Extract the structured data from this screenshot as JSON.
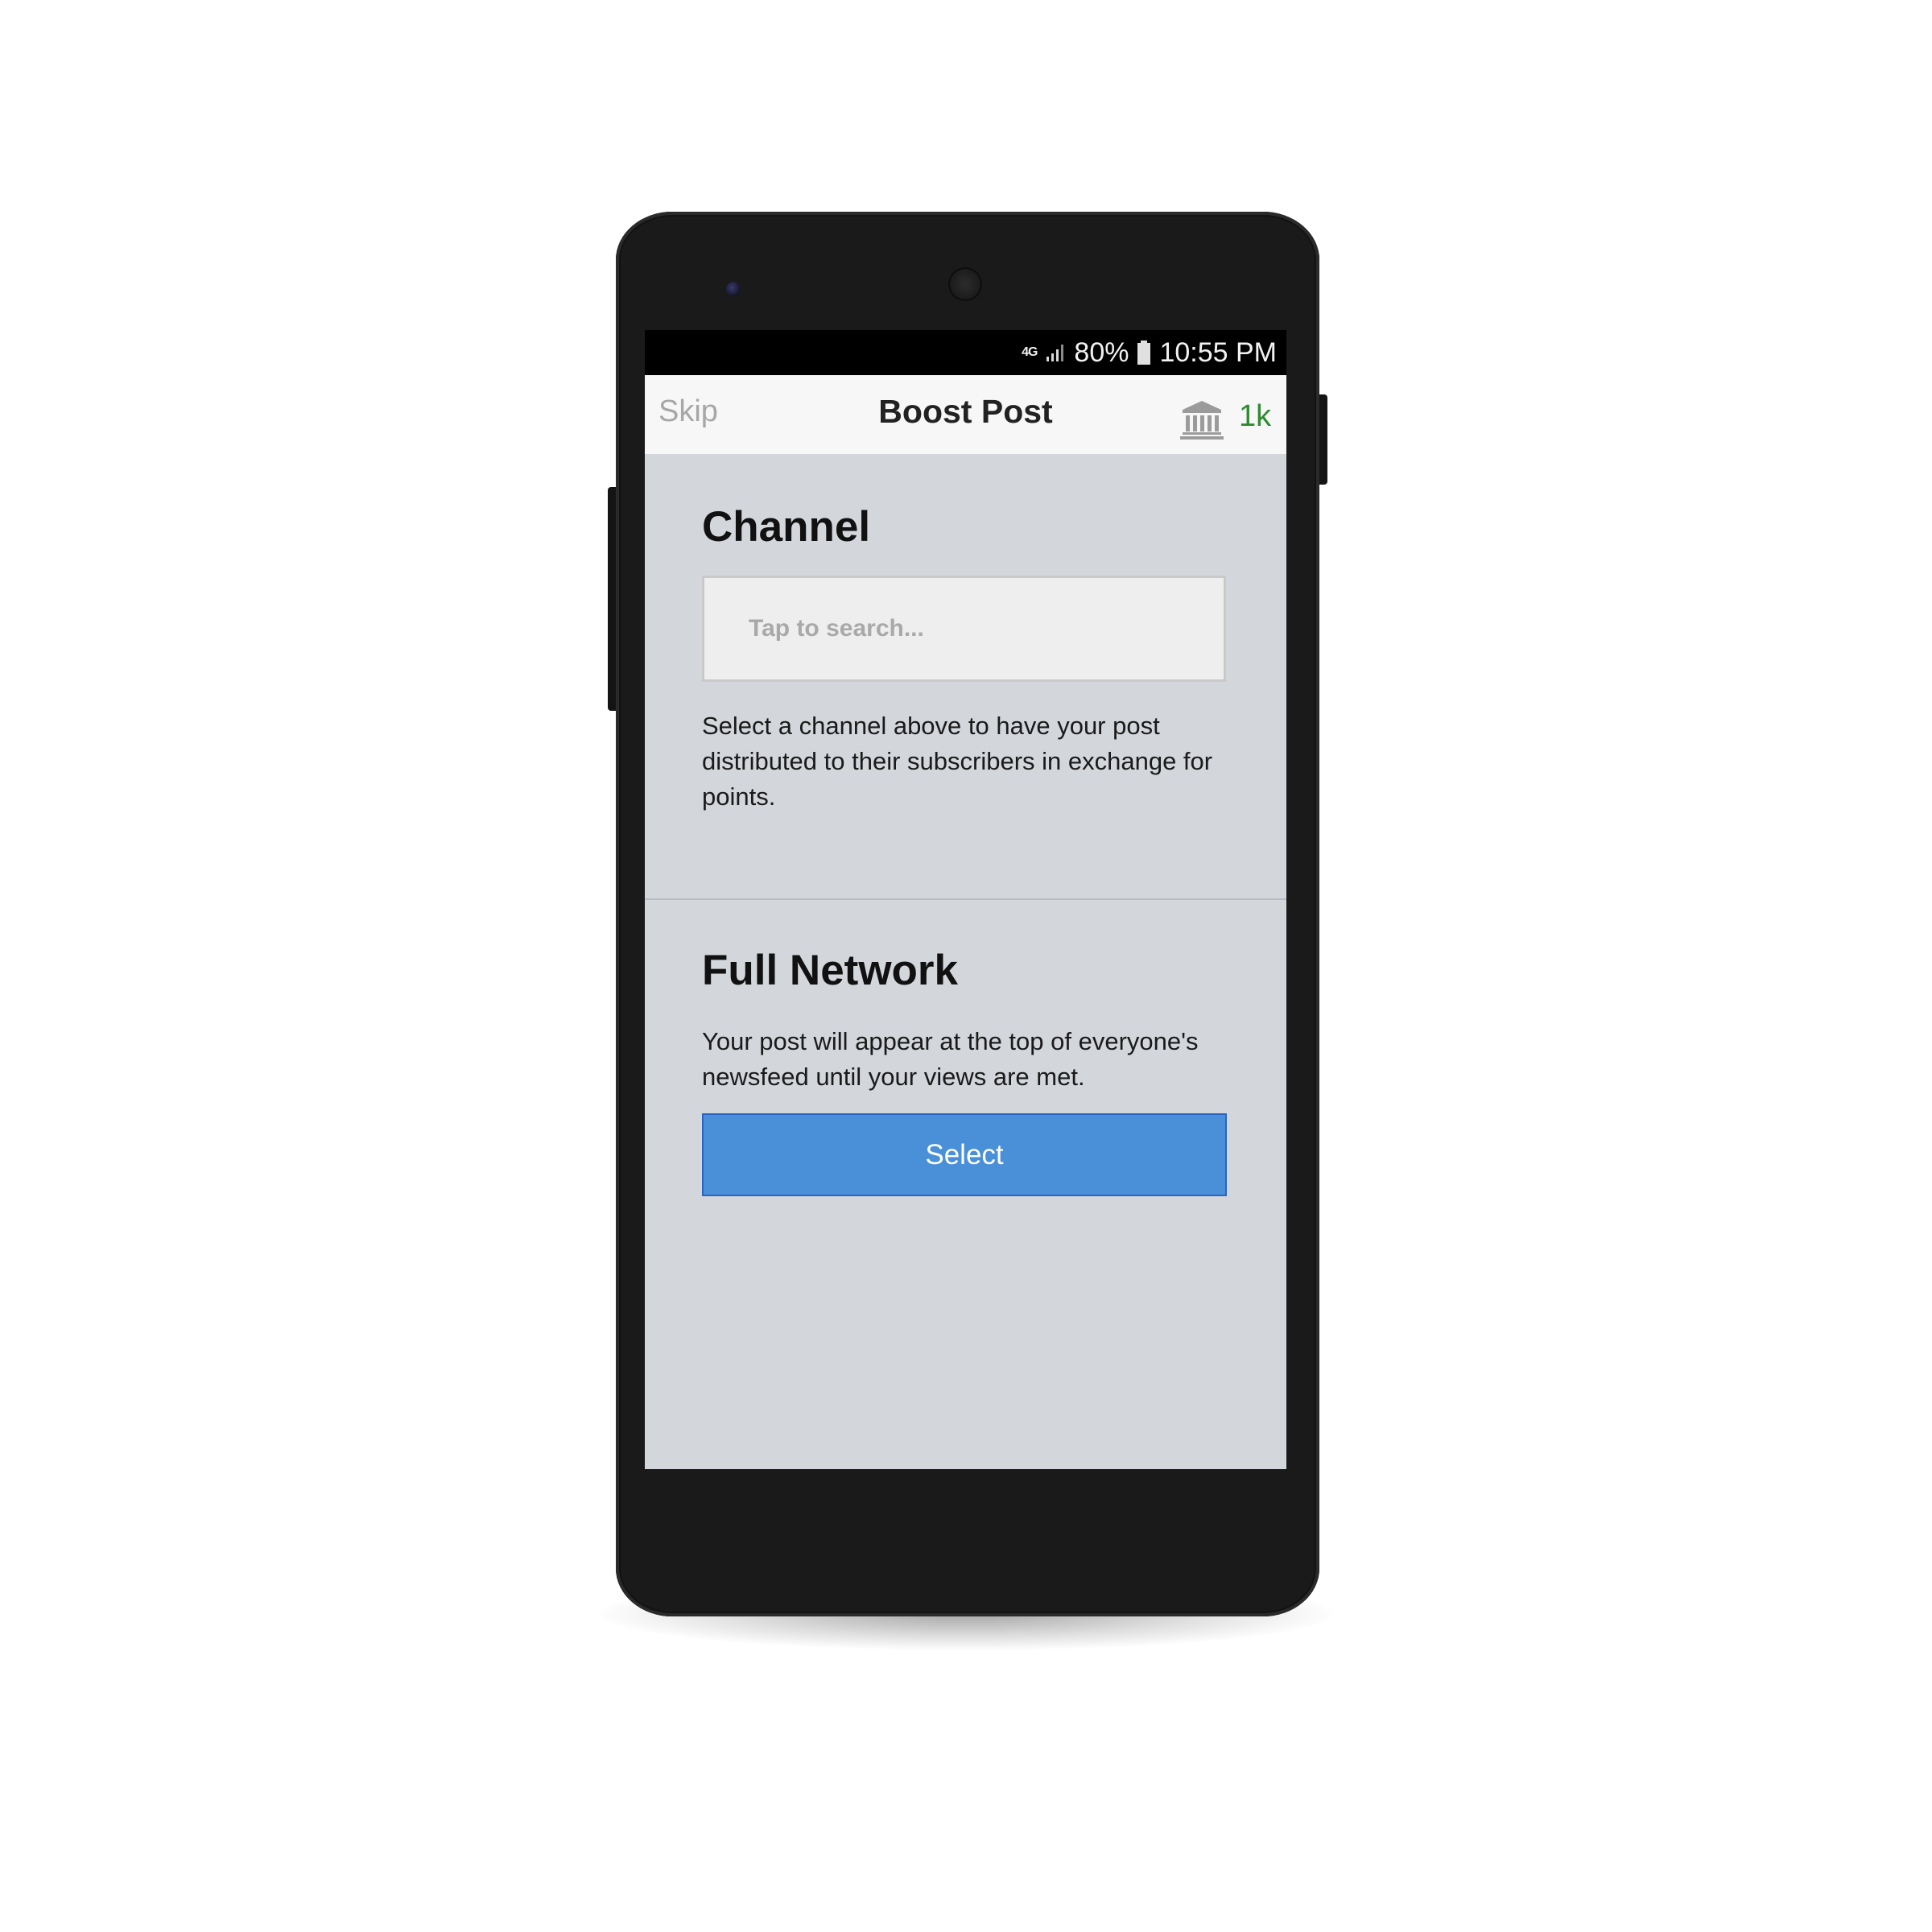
{
  "status_bar": {
    "network": "4G",
    "battery": "80%",
    "time": "10:55 PM"
  },
  "nav": {
    "skip_label": "Skip",
    "title": "Boost Post",
    "points": "1k",
    "points_color": "#2e8b2e",
    "wallet_icon": "bank-icon"
  },
  "channel": {
    "heading": "Channel",
    "search_placeholder": "Tap to search...",
    "description": "Select a channel above to have your post distributed to their subscribers in exchange for points."
  },
  "full_network": {
    "heading": "Full Network",
    "description": "Your post will appear at the top of everyone's newsfeed until your views are met.",
    "button_label": "Select",
    "button_color": "#4a90d9"
  }
}
